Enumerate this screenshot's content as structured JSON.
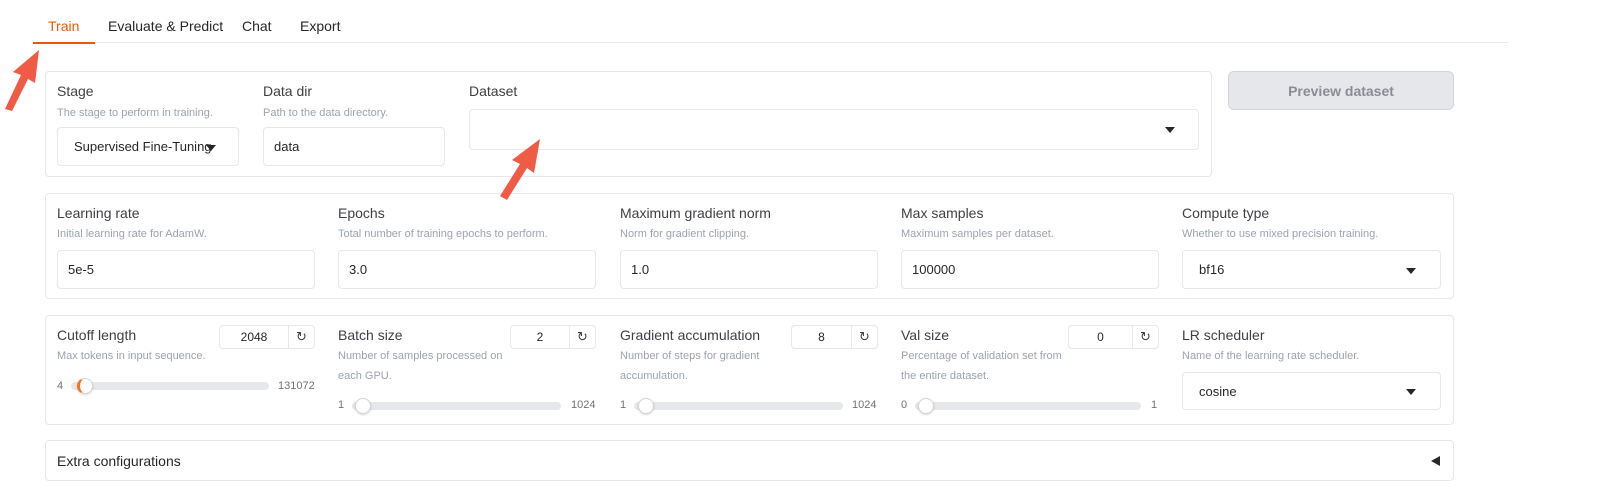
{
  "tabs": [
    {
      "label": "Train",
      "active": true
    },
    {
      "label": "Evaluate & Predict",
      "active": false
    },
    {
      "label": "Chat",
      "active": false
    },
    {
      "label": "Export",
      "active": false
    }
  ],
  "stage": {
    "label": "Stage",
    "info": "The stage to perform in training.",
    "value": "Supervised Fine-Tuning"
  },
  "data_dir": {
    "label": "Data dir",
    "info": "Path to the data directory.",
    "value": "data"
  },
  "dataset": {
    "label": "Dataset",
    "value": ""
  },
  "preview_button": "Preview dataset",
  "learning_rate": {
    "label": "Learning rate",
    "info": "Initial learning rate for AdamW.",
    "value": "5e-5"
  },
  "epochs": {
    "label": "Epochs",
    "info": "Total number of training epochs to perform.",
    "value": "3.0"
  },
  "max_grad_norm": {
    "label": "Maximum gradient norm",
    "info": "Norm for gradient clipping.",
    "value": "1.0"
  },
  "max_samples": {
    "label": "Max samples",
    "info": "Maximum samples per dataset.",
    "value": "100000"
  },
  "compute_type": {
    "label": "Compute type",
    "info": "Whether to use mixed precision training.",
    "value": "bf16"
  },
  "cutoff_len": {
    "label": "Cutoff length",
    "info": "Max tokens in input sequence.",
    "value": "2048",
    "min": "4",
    "max": "131072",
    "fraction": 0.015
  },
  "batch_size": {
    "label": "Batch size",
    "info": "Number of samples processed on each GPU.",
    "value": "2",
    "min": "1",
    "max": "1024",
    "fraction": 0.001
  },
  "grad_accum": {
    "label": "Gradient accumulation",
    "info": "Number of steps for gradient accumulation.",
    "value": "8",
    "min": "1",
    "max": "1024",
    "fraction": 0.007
  },
  "val_size": {
    "label": "Val size",
    "info": "Percentage of validation set from the entire dataset.",
    "value": "0",
    "min": "0",
    "max": "1",
    "fraction": 0.0
  },
  "lr_scheduler": {
    "label": "LR scheduler",
    "info": "Name of the learning rate scheduler.",
    "value": "cosine"
  },
  "extra_config": "Extra configurations",
  "icons": {
    "reset": "reset-icon",
    "dropdown": "chevron-down-icon",
    "collapse": "triangle-left-icon",
    "annotation": "red-arrow-icon"
  },
  "colors": {
    "accent": "#ea580c",
    "annotation": "#ef5b45"
  }
}
